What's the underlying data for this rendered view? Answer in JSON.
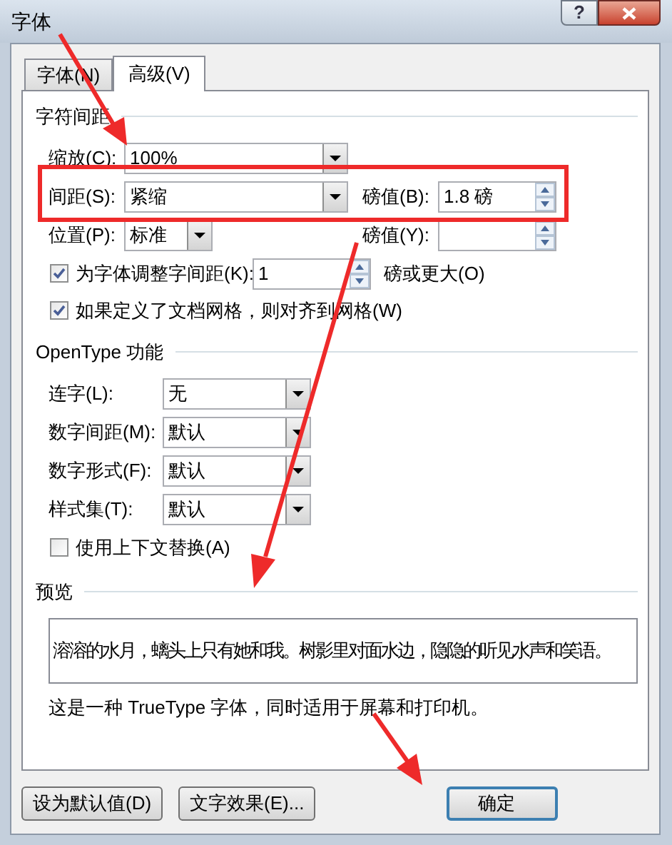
{
  "window": {
    "title": "字体",
    "help": "?"
  },
  "tabs": [
    {
      "label": "字体(N)",
      "selected": false
    },
    {
      "label": "高级(V)",
      "selected": true
    }
  ],
  "character_spacing": {
    "heading": "字符间距",
    "scale": {
      "label": "缩放(C):",
      "value": "100%"
    },
    "spacing": {
      "label": "间距(S):",
      "value": "紧缩",
      "points_label": "磅值(B):",
      "points_value": "1.8 磅"
    },
    "position": {
      "label": "位置(P):",
      "value": "标准",
      "points_label": "磅值(Y):"
    },
    "kerning": {
      "label": "为字体调整字间距(K):",
      "checked": true,
      "value": "1",
      "suffix": "磅或更大(O)"
    },
    "snap_to_grid": {
      "label": "如果定义了文档网格，则对齐到网格(W)",
      "checked": true
    }
  },
  "opentype": {
    "heading": "OpenType 功能",
    "combos": [
      {
        "label": "连字(L):",
        "value": "无"
      },
      {
        "label": "数字间距(M):",
        "value": "默认"
      },
      {
        "label": "数字形式(F):",
        "value": "默认"
      },
      {
        "label": "样式集(T):",
        "value": "默认"
      }
    ],
    "contextual": {
      "label": "使用上下文替换(A)",
      "checked": false
    }
  },
  "preview": {
    "heading": "预览",
    "sample": "溶溶的水月，螭头上只有她和我。树影里对面水边，隐隐的听见水声和笑语。",
    "note": "这是一种 TrueType 字体，同时适用于屏幕和打印机。"
  },
  "buttons": [
    {
      "label": "设为默认值(D)",
      "default": false
    },
    {
      "label": "文字效果(E)...",
      "default": false
    },
    {
      "label": "确定",
      "default": true
    }
  ]
}
